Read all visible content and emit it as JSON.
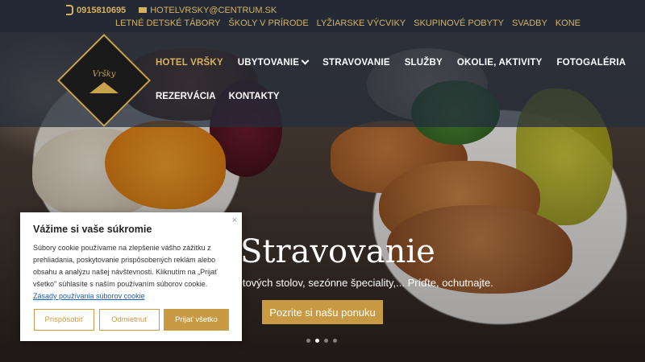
{
  "contact": {
    "phone": "0915810695",
    "email": "HOTELVRSKY@CENTRUM.SK"
  },
  "topnav": [
    "LETNÉ DETSKÉ TÁBORY",
    "ŠKOLY V PRÍRODE",
    "LYŽIARSKE VÝCVIKY",
    "SKUPINOVÉ POBYTY",
    "SVADBY",
    "KONE"
  ],
  "logo": {
    "name": "Vršky"
  },
  "mainnav": {
    "row1": [
      "HOTEL VRŠKY",
      "UBYTOVANIE",
      "STRAVOVANIE",
      "SLUŽBY",
      "OKOLIE, AKTIVITY",
      "FOTOGALÉRIA"
    ],
    "row2": [
      "REZERVÁCIA",
      "KONTAKTY"
    ]
  },
  "hero": {
    "title": "Stravovanie",
    "subtitle": "fetových stolov, sezónne špeciality,... Príďte, ochutnajte.",
    "button": "Pozrite si našu ponuku"
  },
  "cookie": {
    "title": "Vážime si vaše súkromie",
    "text": "Súbory cookie používame na zlepšenie vášho zážitku z prehliadania, poskytovanie prispôsobených reklám alebo obsahu a analýzu našej návštevnosti. Kliknutím na „Prijať všetko\" súhlasíte s naším používaním súborov cookie.",
    "link": "Zásady používania súborov cookie",
    "close": "×",
    "btn_customize": "Prispôsobiť",
    "btn_reject": "Odmietnuť",
    "btn_accept": "Prijať všetko"
  },
  "colors": {
    "accent": "#c99a44",
    "nav_bg": "#232d3c"
  }
}
